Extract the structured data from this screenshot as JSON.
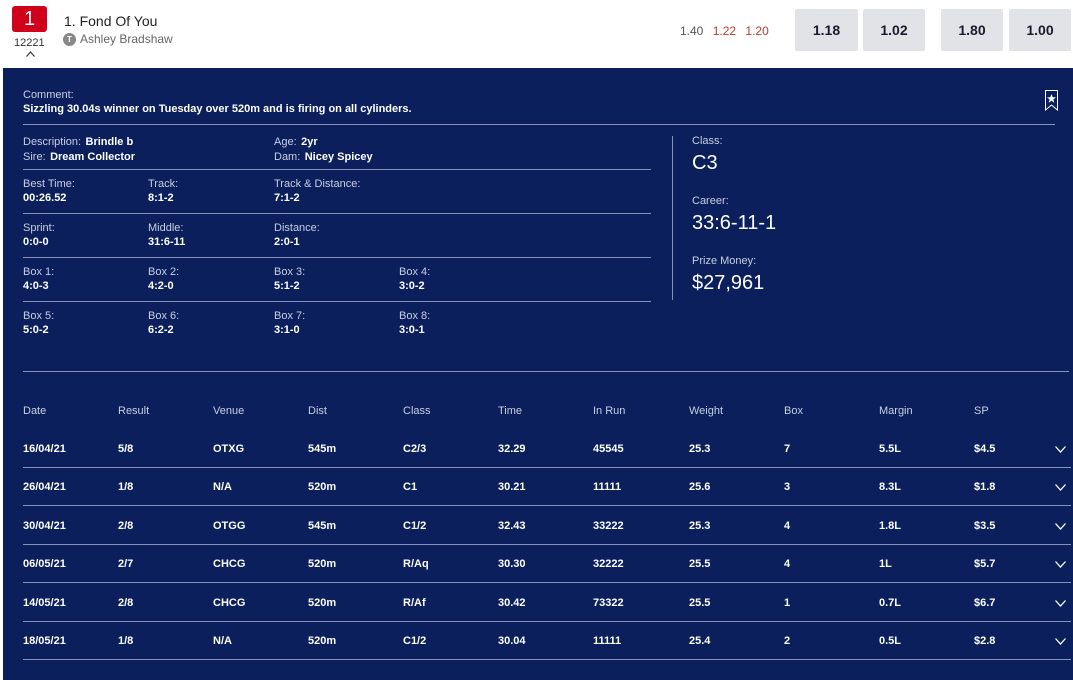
{
  "runner": {
    "box": "1",
    "number": "12221",
    "name": "1. Fond Of You",
    "trainer_icon": "T",
    "trainer": "Ashley Bradshaw"
  },
  "flucs": [
    {
      "value": "1.40",
      "color": "#555555"
    },
    {
      "value": "1.22",
      "color": "#c0392b"
    },
    {
      "value": "1.20",
      "color": "#c0392b"
    }
  ],
  "odds": [
    "1.18",
    "1.02",
    "1.80",
    "1.00"
  ],
  "comment": {
    "label": "Comment:",
    "text": "Sizzling 30.04s winner on Tuesday over 520m and is firing on all cylinders."
  },
  "details": {
    "description_label": "Description:",
    "description": "Brindle b",
    "sire_label": "Sire:",
    "sire": "Dream Collector",
    "age_label": "Age:",
    "age": "2yr",
    "dam_label": "Dam:",
    "dam": "Nicey Spicey"
  },
  "stats": {
    "best_time_label": "Best Time:",
    "best_time": "00:26.52",
    "track_label": "Track:",
    "track": "8:1-2",
    "track_distance_label": "Track & Distance:",
    "track_distance": "7:1-2",
    "sprint_label": "Sprint:",
    "sprint": "0:0-0",
    "middle_label": "Middle:",
    "middle": "31:6-11",
    "distance_label": "Distance:",
    "distance": "2:0-1",
    "boxes": [
      {
        "label": "Box 1:",
        "value": "4:0-3"
      },
      {
        "label": "Box 2:",
        "value": "4:2-0"
      },
      {
        "label": "Box 3:",
        "value": "5:1-2"
      },
      {
        "label": "Box 4:",
        "value": "3:0-2"
      },
      {
        "label": "Box 5:",
        "value": "5:0-2"
      },
      {
        "label": "Box 6:",
        "value": "6:2-2"
      },
      {
        "label": "Box 7:",
        "value": "3:1-0"
      },
      {
        "label": "Box 8:",
        "value": "3:0-1"
      }
    ]
  },
  "summary": {
    "class_label": "Class:",
    "class": "C3",
    "career_label": "Career:",
    "career": "33:6-11-1",
    "prize_label": "Prize Money:",
    "prize": "$27,961"
  },
  "form": {
    "headers": [
      "Date",
      "Result",
      "Venue",
      "Dist",
      "Class",
      "Time",
      "In Run",
      "Weight",
      "Box",
      "Margin",
      "SP"
    ],
    "rows": [
      [
        "16/04/21",
        "5/8",
        "OTXG",
        "545m",
        "C2/3",
        "32.29",
        "45545",
        "25.3",
        "7",
        "5.5L",
        "$4.5"
      ],
      [
        "26/04/21",
        "1/8",
        "N/A",
        "520m",
        "C1",
        "30.21",
        "11111",
        "25.6",
        "3",
        "8.3L",
        "$1.8"
      ],
      [
        "30/04/21",
        "2/8",
        "OTGG",
        "545m",
        "C1/2",
        "32.43",
        "33222",
        "25.3",
        "4",
        "1.8L",
        "$3.5"
      ],
      [
        "06/05/21",
        "2/7",
        "CHCG",
        "520m",
        "R/Aq",
        "30.30",
        "32222",
        "25.5",
        "4",
        "1L",
        "$5.7"
      ],
      [
        "14/05/21",
        "2/8",
        "CHCG",
        "520m",
        "R/Af",
        "30.42",
        "73322",
        "25.5",
        "1",
        "0.7L",
        "$6.7"
      ],
      [
        "18/05/21",
        "1/8",
        "N/A",
        "520m",
        "C1/2",
        "30.04",
        "11111",
        "25.4",
        "2",
        "0.5L",
        "$2.8"
      ]
    ]
  },
  "colors": {
    "panel": "#0a1f5c",
    "badge": "#d0021b",
    "odds_button": "#e2e3e6"
  },
  "icons": {
    "expand": "chevron-up-icon",
    "row_expand": "chevron-down-icon",
    "bookmark": "bookmark-star-icon",
    "trainer": "trainer-icon"
  }
}
